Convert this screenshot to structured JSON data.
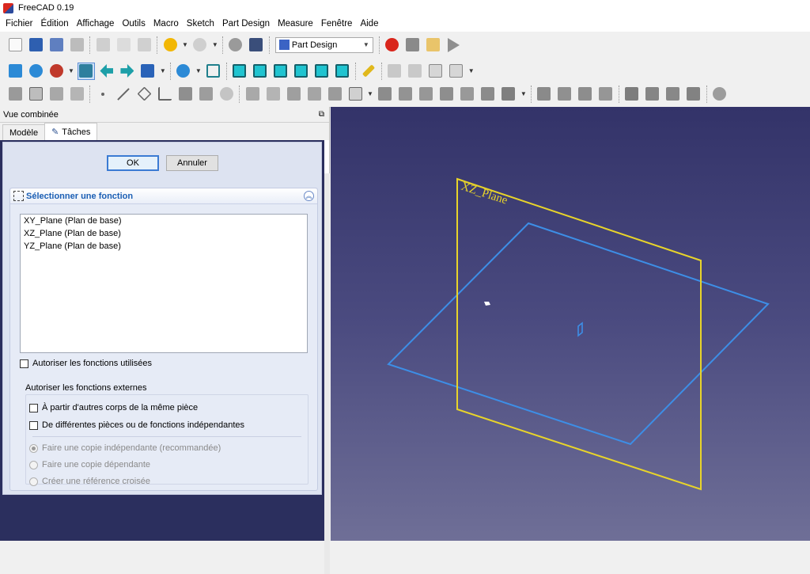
{
  "window": {
    "title": "FreeCAD 0.19"
  },
  "menu": [
    "Fichier",
    "Édition",
    "Affichage",
    "Outils",
    "Macro",
    "Sketch",
    "Part Design",
    "Measure",
    "Fenêtre",
    "Aide"
  ],
  "workbench": {
    "selected": "Part Design"
  },
  "panel": {
    "title": "Vue combinée",
    "tabs": [
      {
        "label": "Modèle"
      },
      {
        "label": "Tâches"
      }
    ],
    "active_tab": "Tâches",
    "ok_label": "OK",
    "cancel_label": "Annuler",
    "box_title": "Sélectionner une fonction",
    "features": [
      "XY_Plane (Plan de base)",
      "XZ_Plane (Plan de base)",
      "YZ_Plane (Plan de base)"
    ],
    "allow_used_label": "Autoriser les fonctions utilisées",
    "allow_external_label": "Autoriser les fonctions externes",
    "other_bodies_label": "À partir d'autres corps de la même pièce",
    "other_parts_label": "De différentes pièces ou de fonctions indépendantes",
    "radio_options": [
      "Faire une copie indépendante (recommandée)",
      "Faire une copie dépendante",
      "Créer une référence croisée"
    ],
    "radio_selected": 0
  },
  "viewport": {
    "planes": [
      {
        "name": "XZ_Plane",
        "color": "#e8d42a",
        "label_visible": true
      },
      {
        "name": "XY_Plane",
        "color": "#3d8ee6",
        "label_visible": false
      }
    ]
  },
  "colors": {
    "accent": "#1b5fb4",
    "record": "#d9261c"
  }
}
